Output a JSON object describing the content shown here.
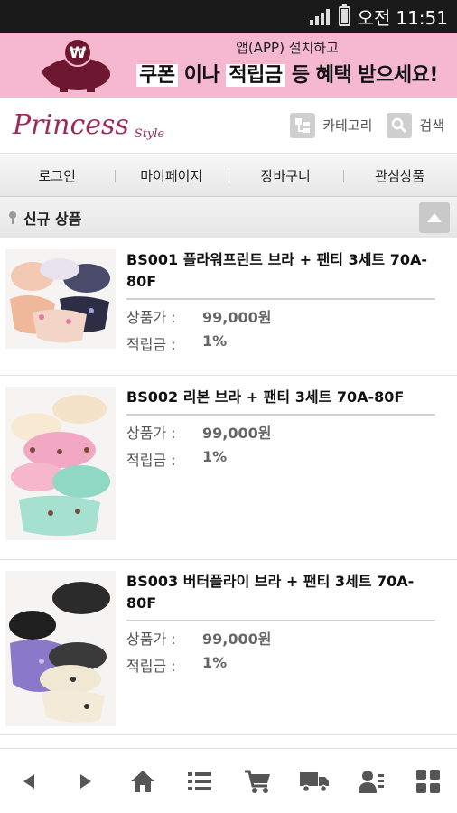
{
  "status": {
    "ampm": "오전",
    "time": "11:51"
  },
  "banner": {
    "line1": "앱(APP) 설치하고",
    "line2_part1": "쿠폰",
    "line2_part2": "이나",
    "line2_part3": "적립금",
    "line2_part4": "등 혜택 받으세요!",
    "coin_symbol": "₩"
  },
  "header": {
    "logo_main": "Princess",
    "logo_sub": "Style",
    "category_label": "카테고리",
    "search_label": "검색"
  },
  "nav": [
    "로그인",
    "마이페이지",
    "장바구니",
    "관심상품"
  ],
  "section": {
    "title": "신규 상품"
  },
  "labels": {
    "price": "상품가 :",
    "points": "적립금 :"
  },
  "products": [
    {
      "title": "BS001 플라워프린트 브라 + 팬티 3세트 70A-80F",
      "price": "99,000원",
      "points": "1%"
    },
    {
      "title": "BS002 리본 브라 + 팬티 3세트 70A-80F",
      "price": "99,000원",
      "points": "1%"
    },
    {
      "title": "BS003 버터플라이 브라 + 팬티 3세트 70A-80F",
      "price": "99,000원",
      "points": "1%"
    }
  ],
  "bottom_icons": [
    "arrow-left-icon",
    "arrow-right-icon",
    "home-icon",
    "list-icon",
    "cart-icon",
    "delivery-truck-icon",
    "user-menu-icon",
    "grid-icon"
  ],
  "colors": {
    "banner_bg": "#f6b8cf",
    "logo": "#9c2b59",
    "status_bg": "#1a1a1a"
  }
}
